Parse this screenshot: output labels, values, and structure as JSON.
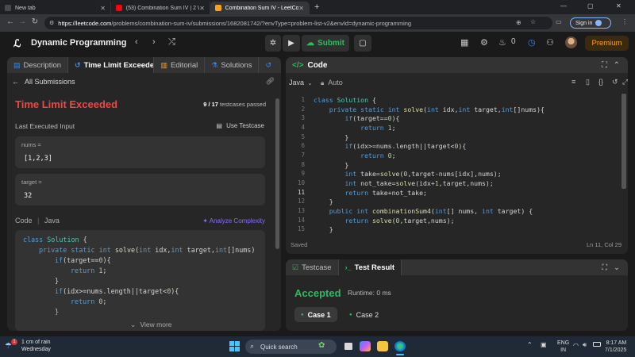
{
  "browser": {
    "tabs": [
      {
        "label": "New tab",
        "active": false,
        "favicon_color": "#4a4a4a"
      },
      {
        "label": "(53) Combination Sum IV | 2 Ways",
        "active": false,
        "favicon_color": "#ff0000"
      },
      {
        "label": "Combination Sum IV - LeetCode",
        "active": true,
        "favicon_color": "#ffa116"
      }
    ],
    "new_tab": "+",
    "url_host": "https://leetcode.com",
    "url_path": "/problems/combination-sum-iv/submissions/1682081742/?envType=problem-list-v2&envId=dynamic-programming",
    "sign_in": "Sign in",
    "window_controls": [
      "—",
      "▢",
      "✕"
    ]
  },
  "lc_header": {
    "problem_list": "Dynamic Programming",
    "submit": "Submit",
    "coins": "0",
    "premium": "Premium"
  },
  "left_panel": {
    "tabs": [
      "Description",
      "Time Limit Exceeded",
      "Editorial",
      "Solutions"
    ],
    "back_link": "All Submissions",
    "status": "Time Limit Exceeded",
    "passed_count": "9 / 17",
    "passed_label": "testcases passed",
    "last_input_label": "Last Executed Input",
    "use_testcase": "Use Testcase",
    "inputs": [
      {
        "name": "nums =",
        "value": "[1,2,3]"
      },
      {
        "name": "target =",
        "value": "32"
      }
    ],
    "code_label": "Code",
    "code_lang": "Java",
    "analyze": "Analyze Complexity",
    "view_more": "View more"
  },
  "code_panel": {
    "title": "Code",
    "language": "Java",
    "auto": "Auto",
    "saved": "Saved",
    "cursor": "Ln 11, Col 29",
    "line_numbers": [
      "1",
      "2",
      "3",
      "4",
      "5",
      "6",
      "7",
      "8",
      "9",
      "10",
      "11",
      "12",
      "13",
      "14",
      "15"
    ],
    "current_line": "11",
    "breakpoint_line": "14"
  },
  "test_panel": {
    "tab_testcase": "Testcase",
    "tab_result": "Test Result",
    "result": "Accepted",
    "runtime": "Runtime: 0 ms",
    "cases": [
      "Case 1",
      "Case 2"
    ]
  },
  "taskbar": {
    "weather_line1": "1 cm of rain",
    "weather_line2": "Wednesday",
    "weather_badge": "1",
    "search": "Quick search",
    "lang_line1": "ENG",
    "lang_line2": "IN",
    "time": "8:17 AM",
    "date": "7/1/2025"
  },
  "colors": {
    "accent_orange": "#ffa116",
    "accepted_green": "#2cbb5d",
    "error_red": "#ef4743",
    "analyze_purple": "#8a6ef5"
  }
}
